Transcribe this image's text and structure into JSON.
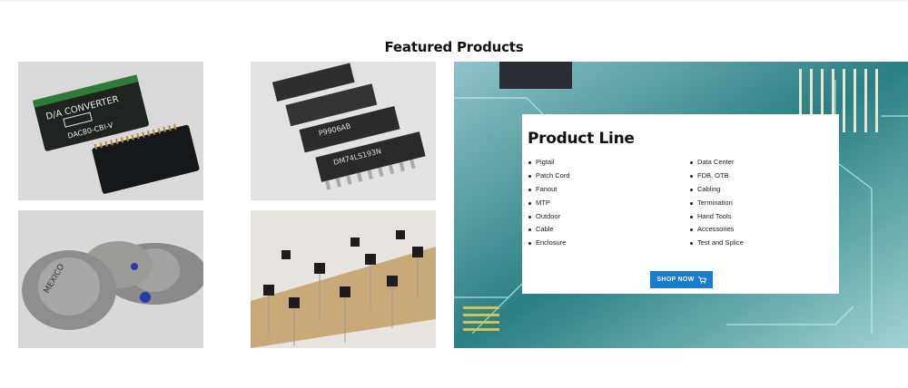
{
  "section": {
    "title": "Featured Products"
  },
  "thumbnails": [
    {
      "name": "da-converter-module",
      "printed_text": [
        "D/A CONVERTER",
        "DAC80-CBI-V"
      ]
    },
    {
      "name": "dip-ic-chips",
      "printed_text": [
        "P9906AB",
        "DM74LS193N"
      ]
    },
    {
      "name": "to3-power-transistors",
      "printed_text": [
        "MEXICO"
      ]
    },
    {
      "name": "to92-transistors",
      "printed_text": []
    }
  ],
  "product_line": {
    "title": "Product Line",
    "left_items": [
      "Pigtail",
      "Patch Cord",
      "Fanout",
      "MTP",
      "Outdoor",
      "Cable",
      "Enclosure"
    ],
    "right_items": [
      "Data Center",
      "FDB, OTB",
      "Cabling",
      "Termination",
      "Hand Tools",
      "Accessories",
      "Test and Splice"
    ],
    "shop_button": "SHOP NOW",
    "shop_icon": "cart-icon",
    "accent": "#1a7bd1"
  }
}
